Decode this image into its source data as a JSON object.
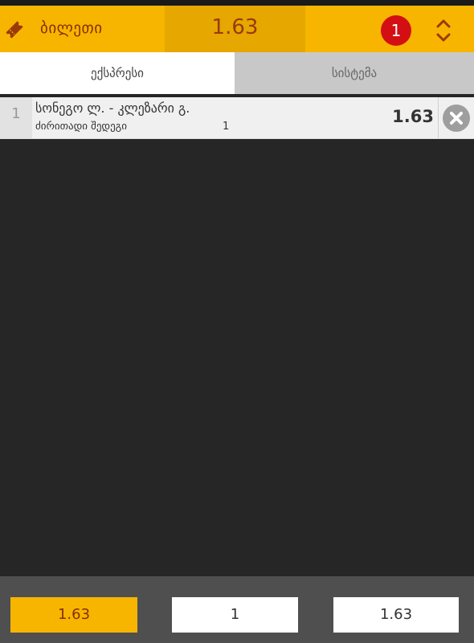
{
  "header": {
    "title": "ბილეთი",
    "total_odds": "1.63",
    "bet_count": "1",
    "icons": {
      "ticket": "ticket-icon",
      "expand": "expand-collapse-icon"
    }
  },
  "tabs": [
    {
      "label": "ექსპრესი",
      "active": true
    },
    {
      "label": "სისტემა",
      "active": false
    }
  ],
  "bets": [
    {
      "index": "1",
      "match": "სონეგო ლ. - კლეზარი გ.",
      "market": "ძირითადი შედეგი",
      "pick": "1",
      "odds": "1.63"
    }
  ],
  "footer": {
    "odds_value": "1.63",
    "stake_value": "1",
    "win_value": "1.63"
  },
  "colors": {
    "accent": "#f7b500",
    "accent_dark": "#e5a700",
    "badge": "#d40f14",
    "background": "#262626"
  }
}
